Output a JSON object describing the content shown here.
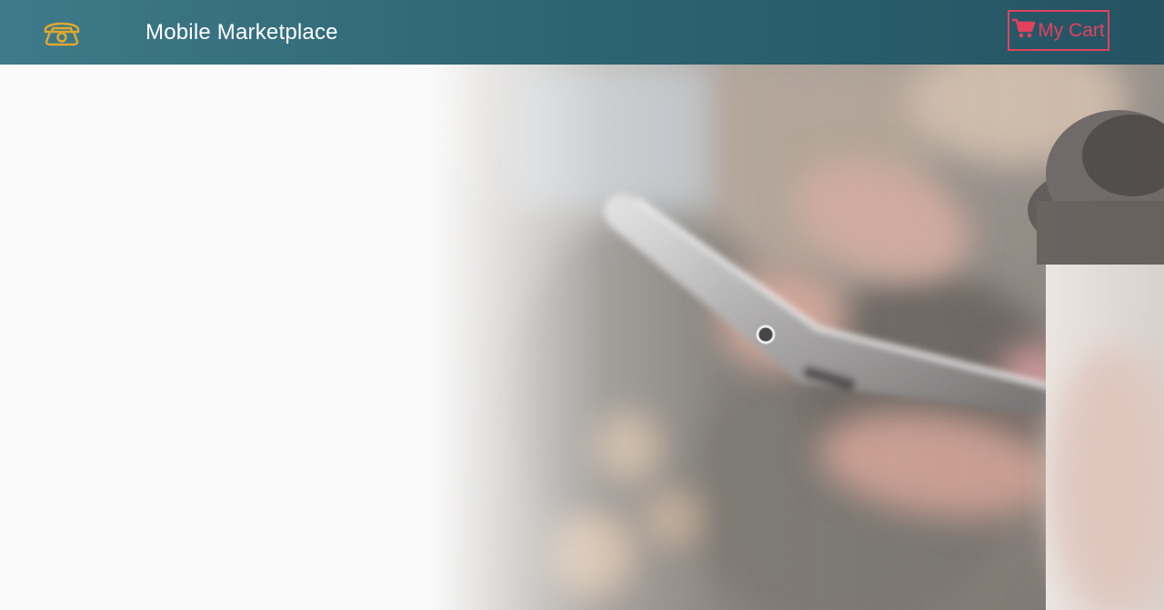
{
  "header": {
    "brand_title": "Mobile Marketplace",
    "cart_label": "My Cart",
    "phone_icon": "telephone-icon",
    "cart_icon": "shopping-cart-icon"
  },
  "hero": {
    "image_subject": "hand holding smartphone with coffee cup"
  },
  "colors": {
    "header_bg": "#2d6472",
    "accent_gold": "#e0a72e",
    "cart_accent": "#e2425f",
    "text_light": "#ffffff"
  }
}
